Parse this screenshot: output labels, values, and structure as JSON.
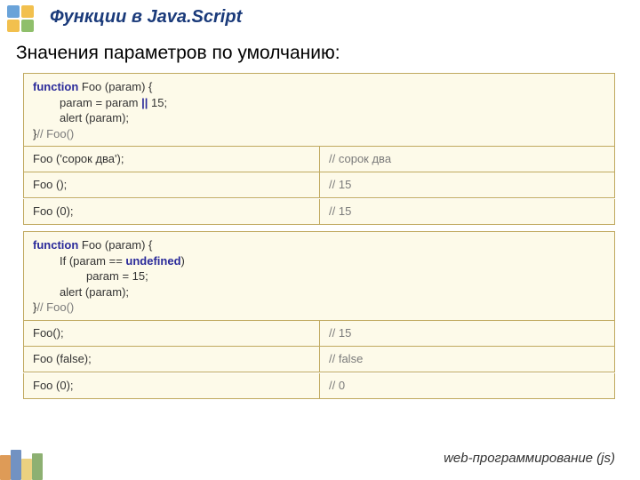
{
  "header": {
    "title": "Функции в Java.Script"
  },
  "subtitle": "Значения параметров по умолчанию:",
  "code1": {
    "l1a": "function",
    "l1b": " Foo (param) {",
    "l2a": "param = param ",
    "l2b": "||",
    "l2c": " 15;",
    "l3": "alert (param);",
    "l4a": "}",
    "l4b": "// Foo()"
  },
  "rows1": [
    {
      "call": "Foo ('сорок два');",
      "out": "// сорок два"
    },
    {
      "call": "Foo ();",
      "out": "// 15"
    },
    {
      "call": "Foo (0);",
      "out": "// 15"
    }
  ],
  "code2": {
    "l1a": "function",
    "l1b": " Foo (param) {",
    "l2a": "If (param == ",
    "l2b": "undefined",
    "l2c": ")",
    "l3": "param = 15;",
    "l4": "alert (param);",
    "l5a": "}",
    "l5b": "// Foo()"
  },
  "rows2": [
    {
      "call": "Foo();",
      "out": "// 15"
    },
    {
      "call": "Foo (false);",
      "out": "// false"
    },
    {
      "call": "Foo (0);",
      "out": "// 0"
    }
  ],
  "footer": "web-программирование (js)"
}
